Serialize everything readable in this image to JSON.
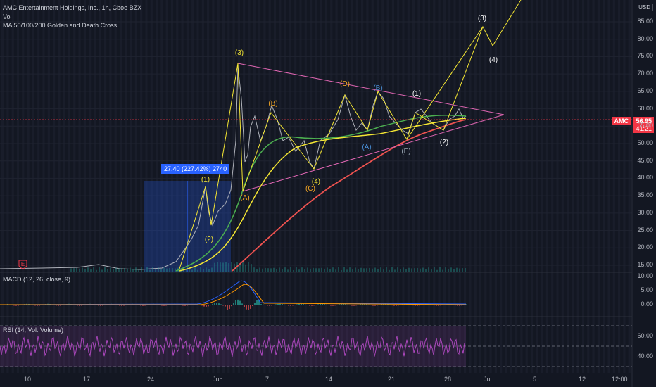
{
  "legend": {
    "symbol": "AMC Entertainment Holdings, Inc., 1h, Cboe BZX",
    "vol": "Vol",
    "ma": "MA 50/100/200 Golden and Death Cross",
    "macd": "MACD (12, 26, close, 9)",
    "rsi": "RSI (14, Vol: Volume)"
  },
  "currency": "USD",
  "ticker_tag": "AMC",
  "last_price": "56.95",
  "countdown": "41:21",
  "measure_label": "27.40 (227.42%) 2740",
  "earnings_badge": "E",
  "chart_data": {
    "type": "line",
    "price_axis": {
      "ticks": [
        "85.00",
        "80.00",
        "75.00",
        "70.00",
        "65.00",
        "60.00",
        "55.00",
        "50.00",
        "45.00",
        "40.00",
        "35.00",
        "30.00",
        "25.00",
        "20.00",
        "15.00"
      ],
      "range": [
        13,
        89
      ]
    },
    "macd_axis": {
      "ticks": [
        "10.00",
        "5.00",
        "0.00"
      ]
    },
    "rsi_axis": {
      "ticks": [
        "60.00",
        "40.00"
      ]
    },
    "x_ticks": [
      "10",
      "17",
      "24",
      "Jun",
      "7",
      "14",
      "21",
      "28",
      "Jul",
      "5",
      "12",
      "12:00"
    ],
    "wave_labels": [
      {
        "text": "(1)",
        "color": "#f5e733"
      },
      {
        "text": "(2)",
        "color": "#f5e733"
      },
      {
        "text": "(3)",
        "color": "#f5e733"
      },
      {
        "text": "(A)",
        "color": "#f5a623"
      },
      {
        "text": "(B)",
        "color": "#f5a623"
      },
      {
        "text": "(4)",
        "color": "#f5e733"
      },
      {
        "text": "(C)",
        "color": "#f5a623"
      },
      {
        "text": "(D)",
        "color": "#f5a623"
      },
      {
        "text": "(A)",
        "color": "#4a90d9"
      },
      {
        "text": "(B)",
        "color": "#4a90d9"
      },
      {
        "text": "(E)",
        "color": "#9aa5b1"
      },
      {
        "text": "(1)",
        "color": "#ffffff"
      },
      {
        "text": "(2)",
        "color": "#ffffff"
      },
      {
        "text": "(3)",
        "color": "#ffffff"
      },
      {
        "text": "(4)",
        "color": "#ffffff"
      }
    ],
    "colors": {
      "price": "#b0b3bb",
      "ma50": "#4caf50",
      "ma100": "#f5e733",
      "ma200": "#ef5350",
      "triangle": "#e066b3",
      "waves": "#f5e733",
      "macd": "#2962ff",
      "signal": "#ff9800",
      "rsi": "#ab47bc",
      "last_price": "#f23645"
    }
  }
}
